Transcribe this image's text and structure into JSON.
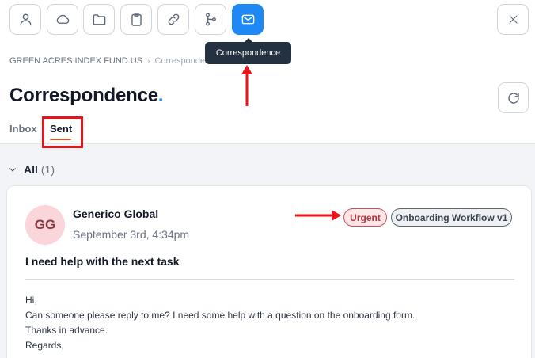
{
  "toolbar": {
    "buttons": [
      {
        "icon": "person-icon",
        "name": "contact-button"
      },
      {
        "icon": "cloud-icon",
        "name": "cloud-button"
      },
      {
        "icon": "folder-icon",
        "name": "folder-button"
      },
      {
        "icon": "clipboard-icon",
        "name": "clipboard-button"
      },
      {
        "icon": "link-icon",
        "name": "link-button"
      },
      {
        "icon": "workflow-icon",
        "name": "workflow-button"
      },
      {
        "icon": "mail-icon",
        "name": "correspondence-button",
        "active": true
      }
    ],
    "close_icon": "close-icon",
    "tooltip": "Correspondence"
  },
  "breadcrumb": {
    "parent": "GREEN ACRES INDEX FUND US",
    "current": "Corresponde"
  },
  "page": {
    "title": "Correspondence",
    "title_dot": "."
  },
  "tabs": [
    {
      "label": "Inbox",
      "active": false
    },
    {
      "label": "Sent",
      "active": true
    }
  ],
  "group": {
    "label": "All",
    "count": "(1)"
  },
  "message": {
    "avatar_initials": "GG",
    "sender": "Generico Global",
    "date": "September 3rd, 4:34pm",
    "badges": [
      "Urgent",
      "Onboarding Workflow v1"
    ],
    "subject": "I need help with the next task",
    "body": [
      "Hi,",
      "Can someone please reply to me? I need some help with a question on the onboarding form.",
      "Thanks in advance.",
      "Regards,"
    ]
  },
  "colors": {
    "accent": "#1e88f5",
    "tab_underline": "#e0531f",
    "annotation_red": "#e8141b",
    "urgent_badge_border": "#d94a55",
    "avatar_bg": "#fad5d9"
  }
}
